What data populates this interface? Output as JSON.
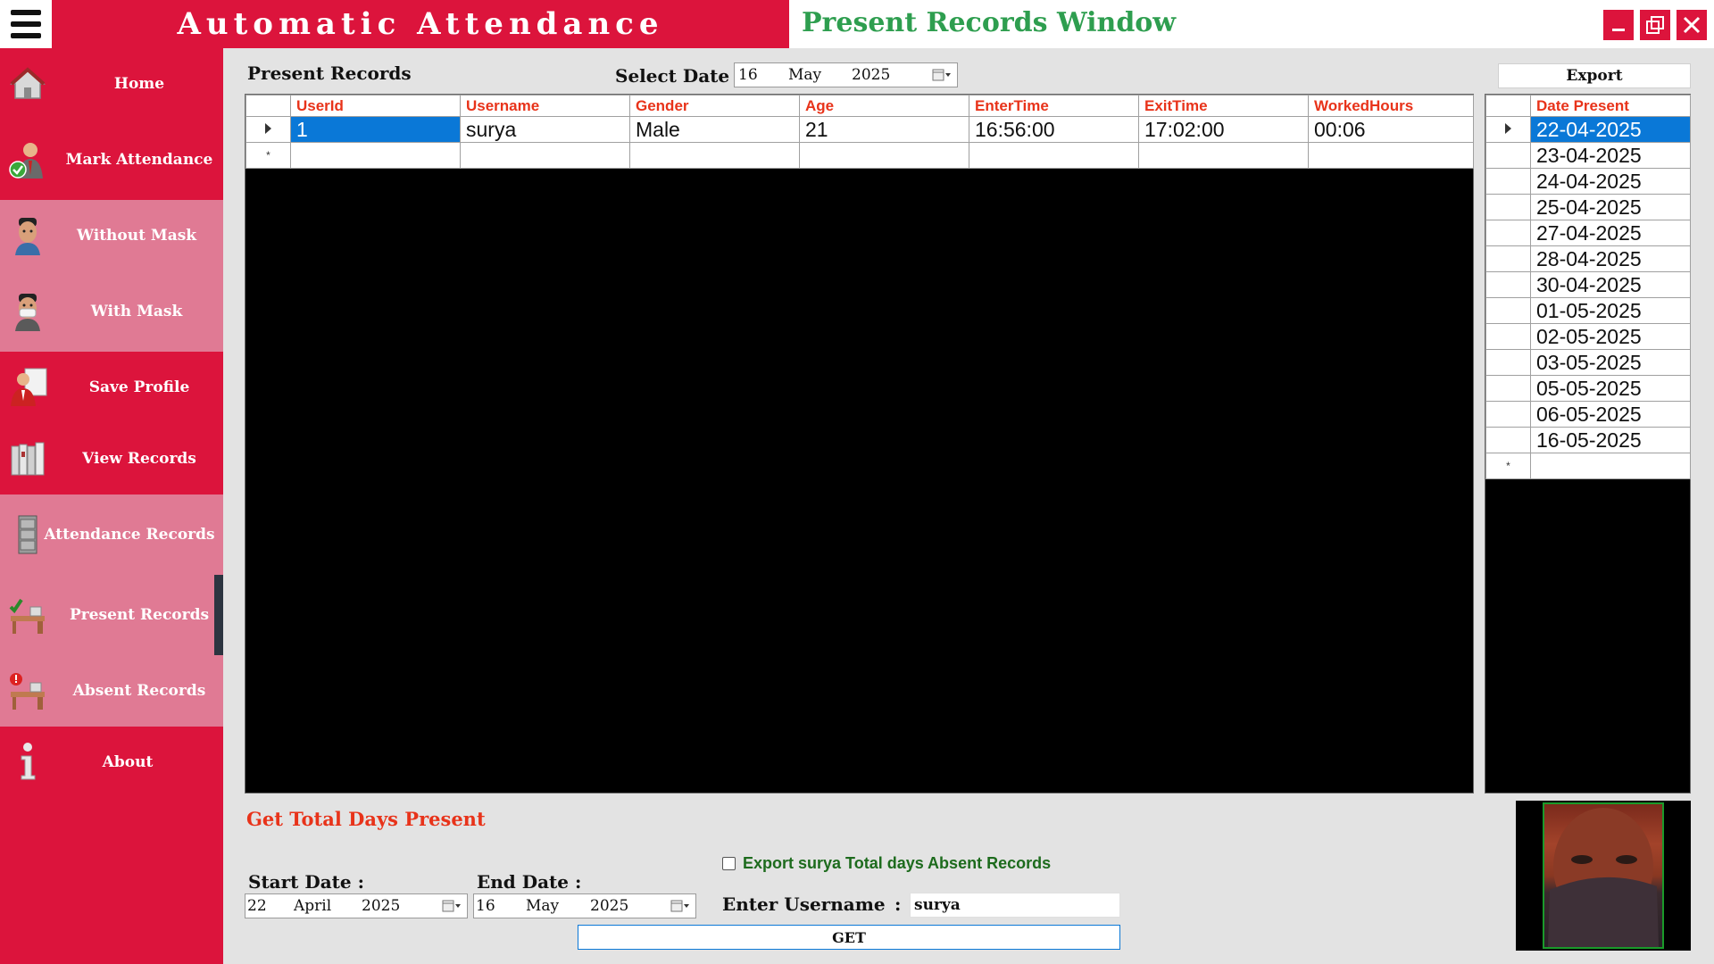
{
  "app": {
    "banner": "Automatic Attendance",
    "window_title": "Present Records Window",
    "controls": {
      "minimize": "_",
      "maximize": "❐",
      "close": "✕"
    }
  },
  "sidebar": {
    "items": [
      {
        "label": "Home",
        "icon": "home-icon"
      },
      {
        "label": "Mark Attendance",
        "icon": "user-check-icon"
      },
      {
        "label": "Without Mask",
        "icon": "face-icon"
      },
      {
        "label": "With Mask",
        "icon": "masked-face-icon"
      },
      {
        "label": "Save Profile",
        "icon": "profile-icon"
      },
      {
        "label": "View Records",
        "icon": "binders-icon"
      },
      {
        "label": "Attendance Records",
        "icon": "cabinet-icon"
      },
      {
        "label": "Present Records",
        "icon": "desk-check-icon",
        "active": true
      },
      {
        "label": "Absent Records",
        "icon": "desk-alert-icon"
      },
      {
        "label": "About",
        "icon": "info-icon"
      }
    ]
  },
  "main": {
    "section_title": "Present Records",
    "select_date": {
      "label": "Select Date :",
      "day": "16",
      "month": "May",
      "year": "2025"
    },
    "export_label": "Export",
    "records_table": {
      "columns": [
        "UserId",
        "Username",
        "Gender",
        "Age",
        "EnterTime",
        "ExitTime",
        "WorkedHours"
      ],
      "rows": [
        [
          "1",
          "surya",
          "Male",
          "21",
          "16:56:00",
          "17:02:00",
          "00:06"
        ]
      ],
      "new_row_marker": "*"
    },
    "dates_table": {
      "column": "Date Present",
      "rows": [
        "22-04-2025",
        "23-04-2025",
        "24-04-2025",
        "25-04-2025",
        "27-04-2025",
        "28-04-2025",
        "30-04-2025",
        "01-05-2025",
        "02-05-2025",
        "03-05-2025",
        "05-05-2025",
        "06-05-2025",
        "16-05-2025"
      ],
      "new_row_marker": "*"
    }
  },
  "total_days": {
    "title": "Get Total Days Present",
    "start_label": "Start Date :",
    "start_date": {
      "day": "22",
      "month": "April",
      "year": "2025"
    },
    "end_label": "End Date :",
    "end_date": {
      "day": "16",
      "month": "May",
      "year": "2025"
    },
    "export_checkbox_label": "Export surya Total days Absent Records",
    "export_checked": false,
    "username_label": "Enter Username",
    "username_sep": ":",
    "username_value": "surya",
    "get_label": "GET"
  },
  "colors": {
    "brand_red": "#dc143c",
    "sidebar_light": "#e07a94",
    "title_green": "#2e9e4f",
    "header_orange": "#e8331a",
    "selection_blue": "#0a78d7"
  }
}
